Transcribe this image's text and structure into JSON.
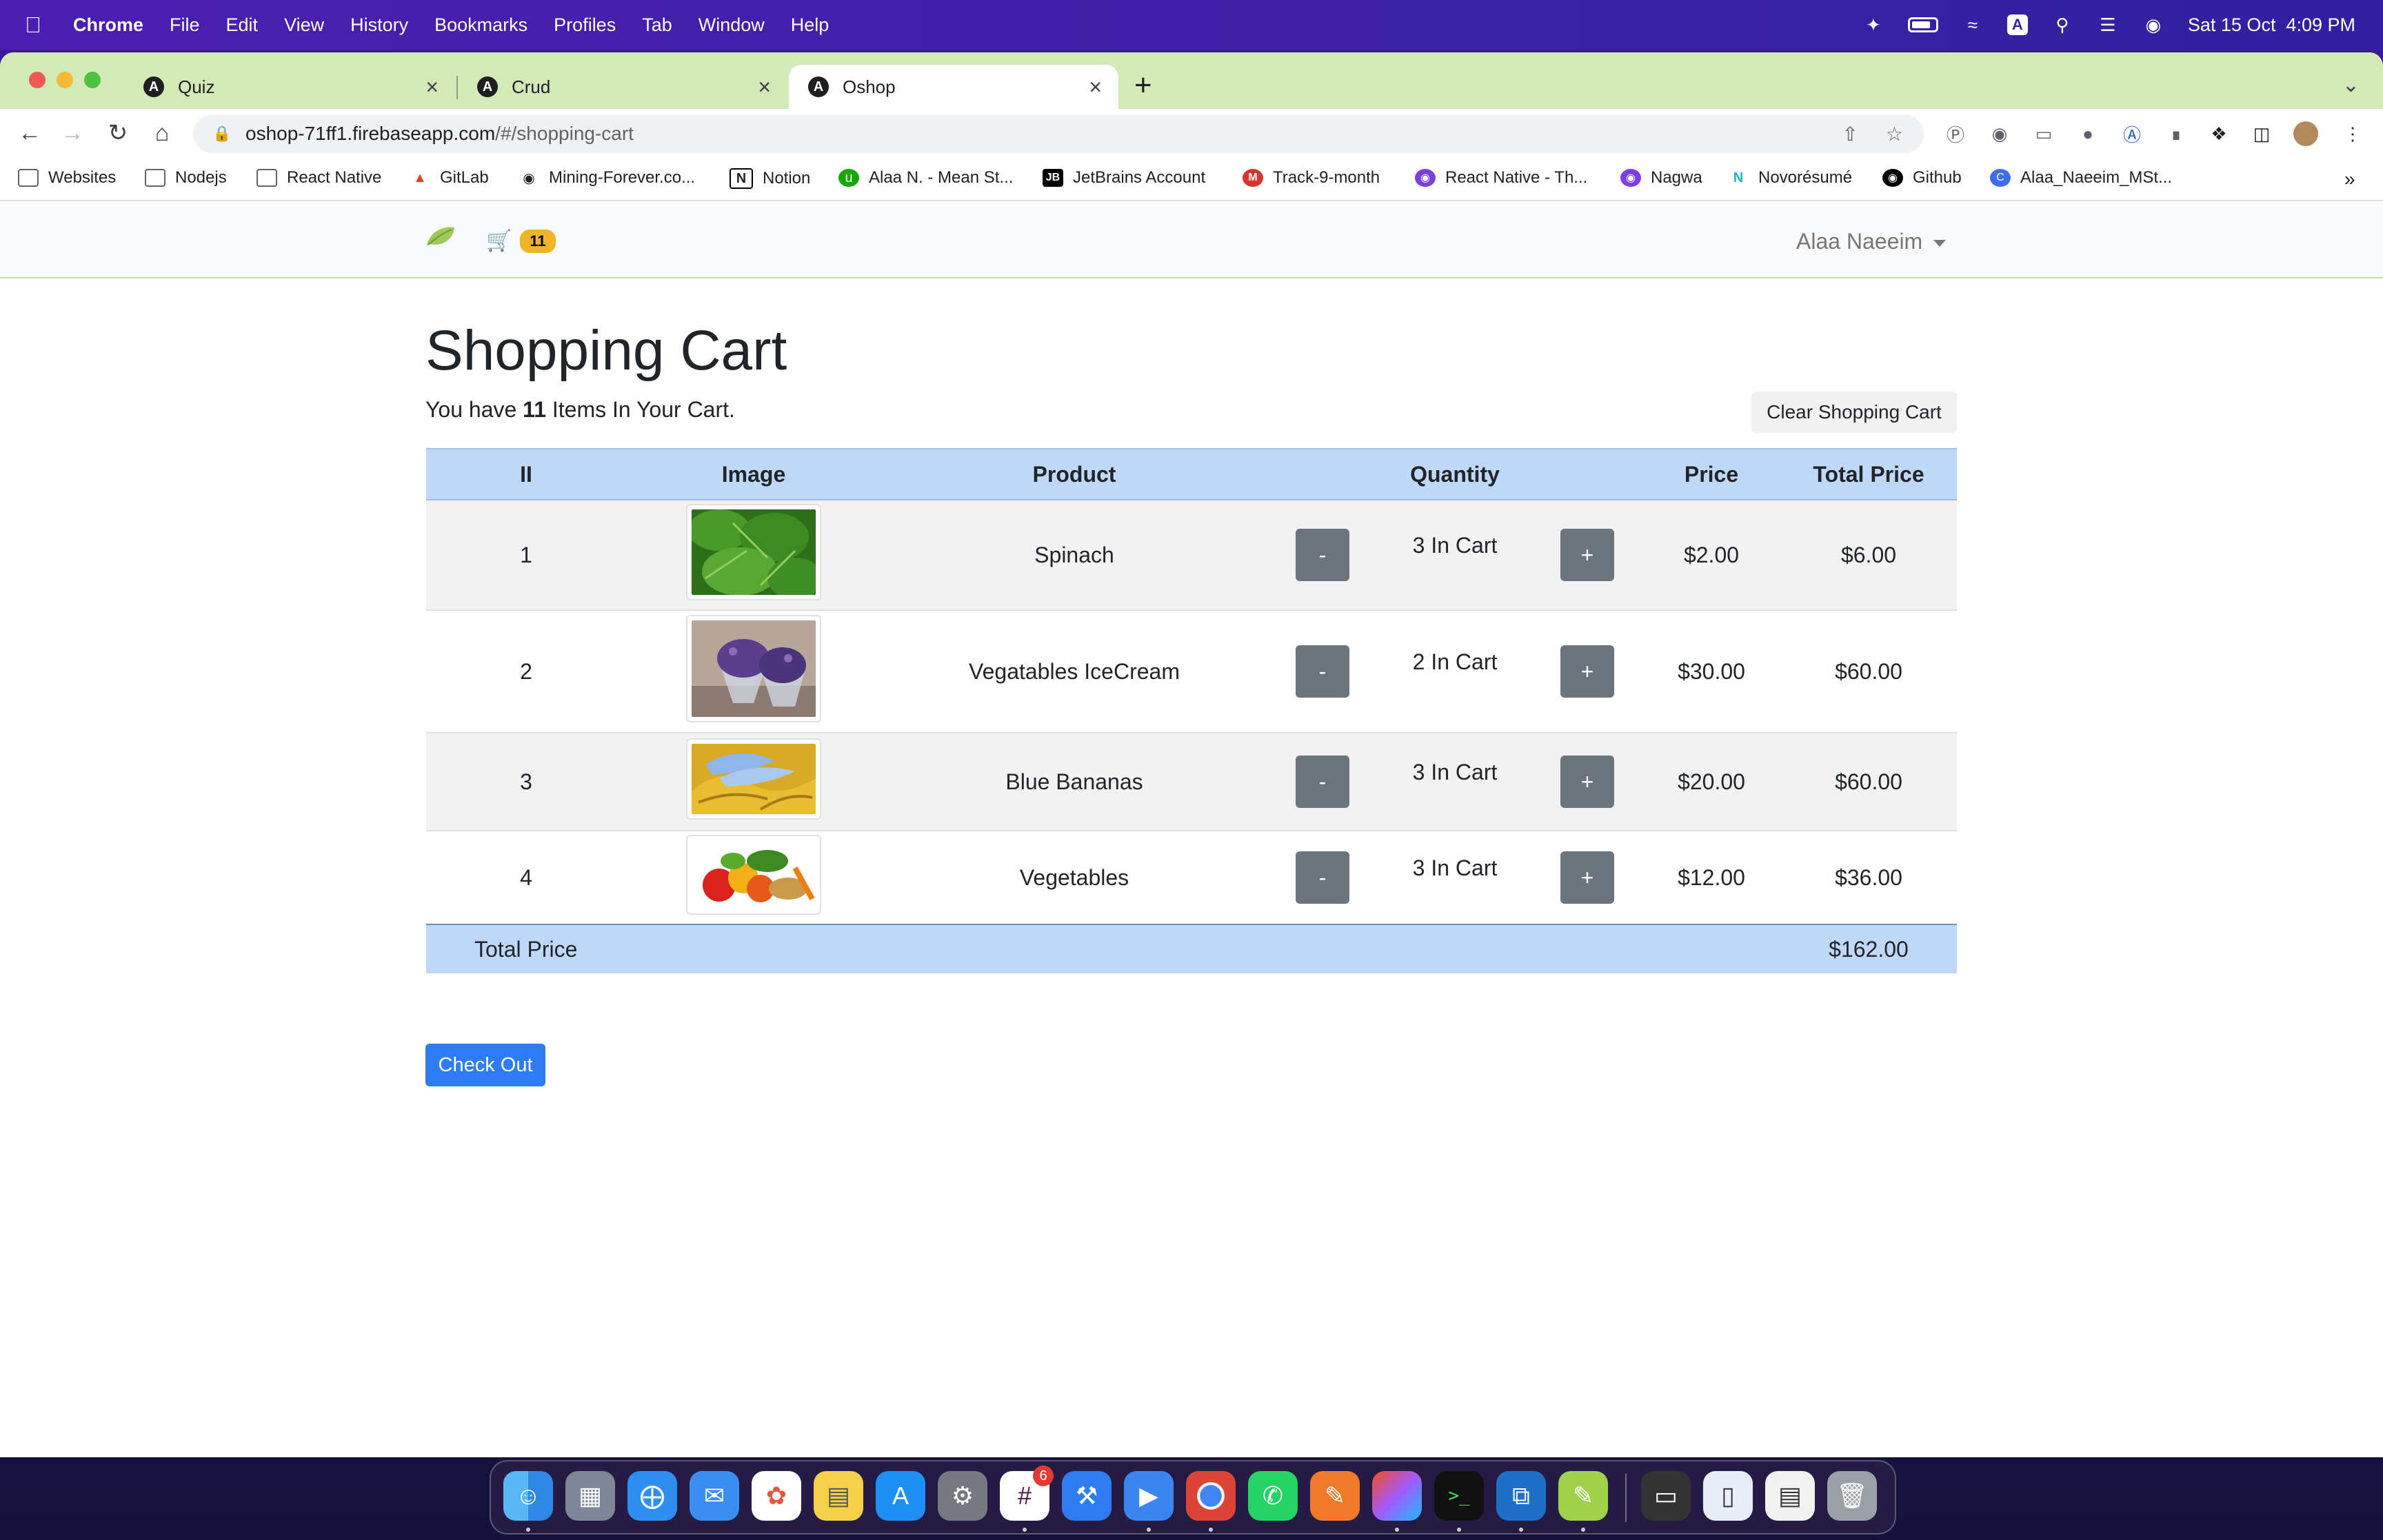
{
  "menubar": {
    "app": "Chrome",
    "items": [
      "File",
      "Edit",
      "View",
      "History",
      "Bookmarks",
      "Profiles",
      "Tab",
      "Window",
      "Help"
    ],
    "clock": "Sat 15 Oct  4:09 PM",
    "input_source": "A"
  },
  "tabs": [
    {
      "title": "Quiz",
      "favicon": "A"
    },
    {
      "title": "Crud",
      "favicon": "A"
    },
    {
      "title": "Oshop",
      "favicon": "A",
      "active": true
    }
  ],
  "omnibox": {
    "host": "oshop-71ff1.firebaseapp.com",
    "path": "/#/shopping-cart"
  },
  "bookmarks": [
    {
      "label": "Websites",
      "icon": "folder-icon"
    },
    {
      "label": "Nodejs",
      "icon": "folder-icon"
    },
    {
      "label": "React Native",
      "icon": "folder-icon"
    },
    {
      "label": "GitLab",
      "icon": "gitlab-icon"
    },
    {
      "label": "Mining-Forever.co...",
      "icon": "globe-icon"
    },
    {
      "label": "Notion",
      "icon": "notion-icon"
    },
    {
      "label": "Alaa N. - Mean St...",
      "icon": "upwork-icon"
    },
    {
      "label": "JetBrains Account",
      "icon": "jetbrains-icon"
    },
    {
      "label": "Track-9-month",
      "icon": "track-icon"
    },
    {
      "label": "React Native - Th...",
      "icon": "purple-icon"
    },
    {
      "label": "Nagwa",
      "icon": "purple-icon"
    },
    {
      "label": "Novorésumé",
      "icon": "novoresume-icon"
    },
    {
      "label": "Github",
      "icon": "github-icon"
    },
    {
      "label": "Alaa_Naeeim_MSt...",
      "icon": "canva-icon"
    }
  ],
  "bookmarks_overflow": "»",
  "app": {
    "cart_count": "11",
    "user": "Alaa Naeeim",
    "title": "Shopping Cart",
    "summary_pre": "You have ",
    "summary_count": "11",
    "summary_post": " Items In Your Cart.",
    "clear_label": "Clear Shopping Cart",
    "columns": [
      "II",
      "Image",
      "Product",
      "Quantity",
      "Price",
      "Total Price"
    ],
    "rows": [
      {
        "index": "1",
        "product": "Spinach",
        "quantity": "3 In Cart",
        "price": "$2.00",
        "total": "$6.00",
        "image": "spinach"
      },
      {
        "index": "2",
        "product": "Vegatables IceCream",
        "quantity": "2 In Cart",
        "price": "$30.00",
        "total": "$60.00",
        "image": "icecream"
      },
      {
        "index": "3",
        "product": "Blue Bananas",
        "quantity": "3 In Cart",
        "price": "$20.00",
        "total": "$60.00",
        "image": "bananas"
      },
      {
        "index": "4",
        "product": "Vegetables",
        "quantity": "3 In Cart",
        "price": "$12.00",
        "total": "$36.00",
        "image": "vegetables"
      }
    ],
    "minus_label": "-",
    "plus_label": "+",
    "total_label": "Total Price",
    "total_value": "$162.00",
    "checkout_label": "Check Out"
  },
  "dock": {
    "slack_badge": "6",
    "apps": [
      "Finder",
      "Launchpad",
      "Safari",
      "Mail",
      "Photos",
      "Notes",
      "App Store",
      "System Preferences",
      "Slack",
      "Xcode",
      "Simulator",
      "Chrome",
      "WhatsApp",
      "Pages",
      "Figma",
      "Terminal",
      "VS Code",
      "Sketch"
    ]
  },
  "colors": {
    "accent": "#2f7df6",
    "table_header": "#c0d8f7",
    "tabstrip": "#d3e9b8",
    "badge": "#f0b429",
    "qty_button": "#6c757d"
  }
}
